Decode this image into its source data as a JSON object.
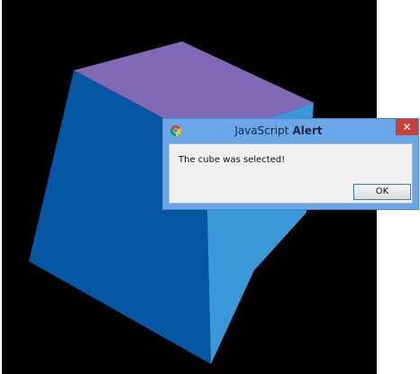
{
  "scene": {
    "object": "cube",
    "colors": {
      "top_face": "#8169b5",
      "front_face": "#0557a3",
      "side_face": "#3b98d8",
      "background": "#000000"
    }
  },
  "alert": {
    "title": "JavaScript",
    "title_emphasis": "Alert",
    "message": "The cube was selected!",
    "ok_label": "OK",
    "close_label": "✕",
    "icon": "chrome-icon"
  }
}
